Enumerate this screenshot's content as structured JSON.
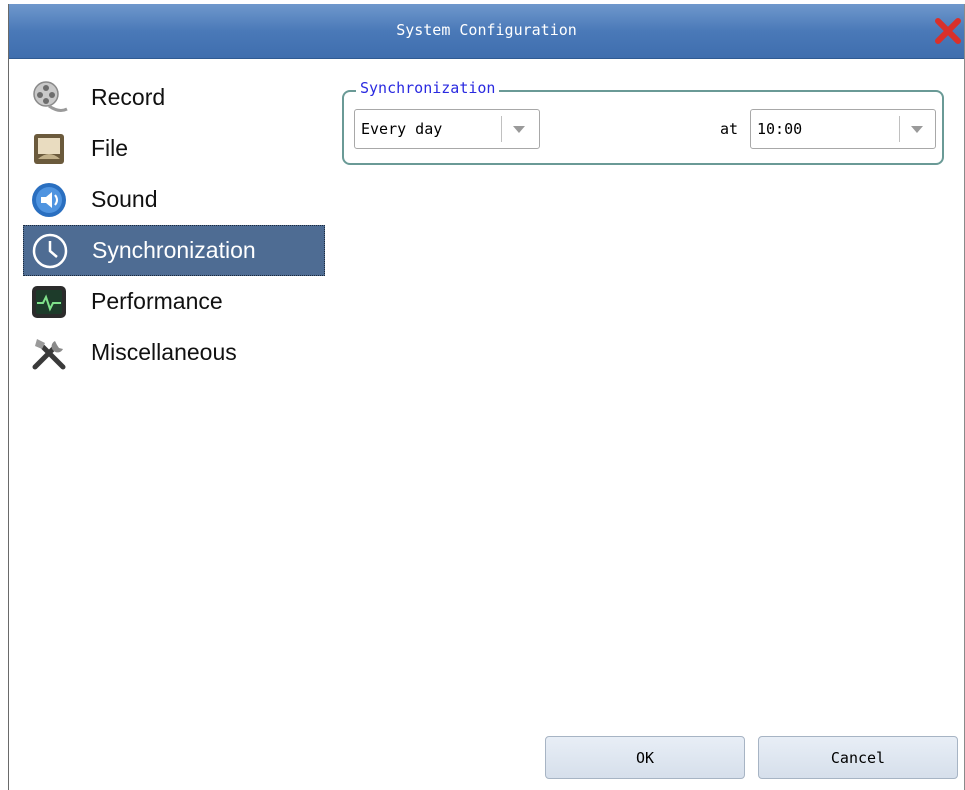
{
  "window": {
    "title": "System Configuration"
  },
  "sidebar": {
    "items": [
      {
        "label": "Record",
        "icon": "film-reel-icon"
      },
      {
        "label": "File",
        "icon": "file-icon"
      },
      {
        "label": "Sound",
        "icon": "speaker-icon"
      },
      {
        "label": "Synchronization",
        "icon": "clock-icon",
        "selected": true
      },
      {
        "label": "Performance",
        "icon": "monitor-pulse-icon"
      },
      {
        "label": "Miscellaneous",
        "icon": "tools-icon"
      }
    ]
  },
  "sync": {
    "group_title": "Synchronization",
    "frequency": "Every day",
    "at_label": "at",
    "time": "10:00"
  },
  "buttons": {
    "ok": "OK",
    "cancel": "Cancel"
  },
  "colors": {
    "title_bar": "#4a79b8",
    "selection": "#4e6c93",
    "group_title": "#2a2ae0",
    "close": "#d9302a"
  }
}
